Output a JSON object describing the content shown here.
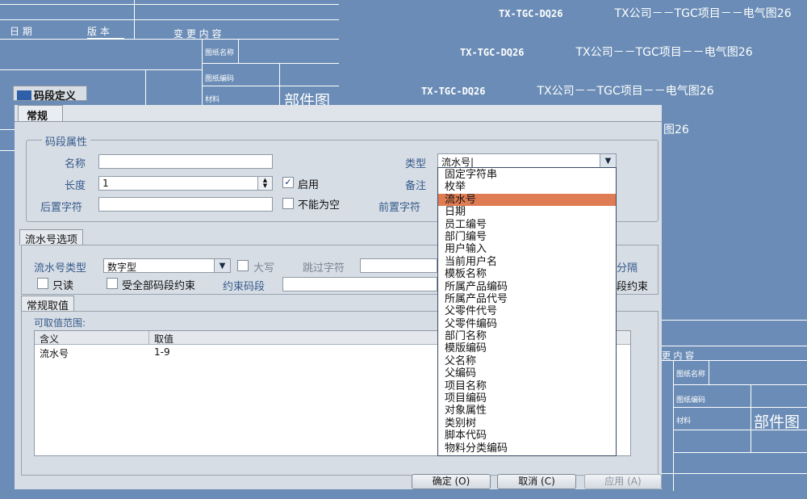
{
  "background": {
    "sheet_labels": {
      "date": "日 期",
      "version": "版 本",
      "change": "变 更 内 容",
      "change_right": "更 内 容",
      "drawing_name": "图纸名称",
      "drawing_code": "图纸编码",
      "material": "材料",
      "parts_drawing": "部件图"
    },
    "watermark_code": "TX-TGC-DQ26",
    "watermark_title": "TX公司－－TGC项目－－电气图26",
    "watermark_partial": "图26"
  },
  "window": {
    "title": "码段定义",
    "main_tab": "常规"
  },
  "segment_props": {
    "legend": "码段属性",
    "name_label": "名称",
    "name_value": "",
    "length_label": "长度",
    "length_value": "1",
    "enable_label": "启用",
    "enable_checked": true,
    "suffix_label": "后置字符",
    "suffix_value": "",
    "not_null_label": "不能为空",
    "not_null_checked": false,
    "type_label": "类型",
    "type_value": "流水号",
    "remark_label": "备注",
    "prefix_label": "前置字符"
  },
  "serial_options": {
    "tab": "流水号选项",
    "serial_type_label": "流水号类型",
    "serial_type_value": "数字型",
    "uppercase_label": "大写",
    "skip_chars_label": "跳过字符",
    "readonly_label": "只读",
    "bound_all_label": "受全部码段约束",
    "constraint_code_label": "约束码段",
    "separator_partial": "分隔",
    "constraint_partial": "段约束"
  },
  "values_tab": {
    "tab": "常规取值",
    "range_label": "可取值范围:",
    "columns": [
      "含义",
      "取值"
    ],
    "rows": [
      [
        "流水号",
        "1-9"
      ]
    ]
  },
  "type_options": [
    "固定字符串",
    "枚举",
    "流水号",
    "日期",
    "员工编号",
    "部门编号",
    "用户输入",
    "当前用户名",
    "模板名称",
    "所属产品编码",
    "所属产品代号",
    "父零件代号",
    "父零件编码",
    "部门名称",
    "模版编码",
    "父名称",
    "父编码",
    "项目名称",
    "项目编码",
    "对象属性",
    "类别树",
    "脚本代码",
    "物料分类编码"
  ],
  "selected_type_index": 2,
  "buttons": {
    "ok": "确定 (O)",
    "cancel": "取消 (C)",
    "apply": "应用 (A)"
  },
  "colors": {
    "background": "#6a8cb6",
    "dialog": "#d7dde4",
    "label_blue": "#355a8c",
    "selection": "#e07c53"
  }
}
